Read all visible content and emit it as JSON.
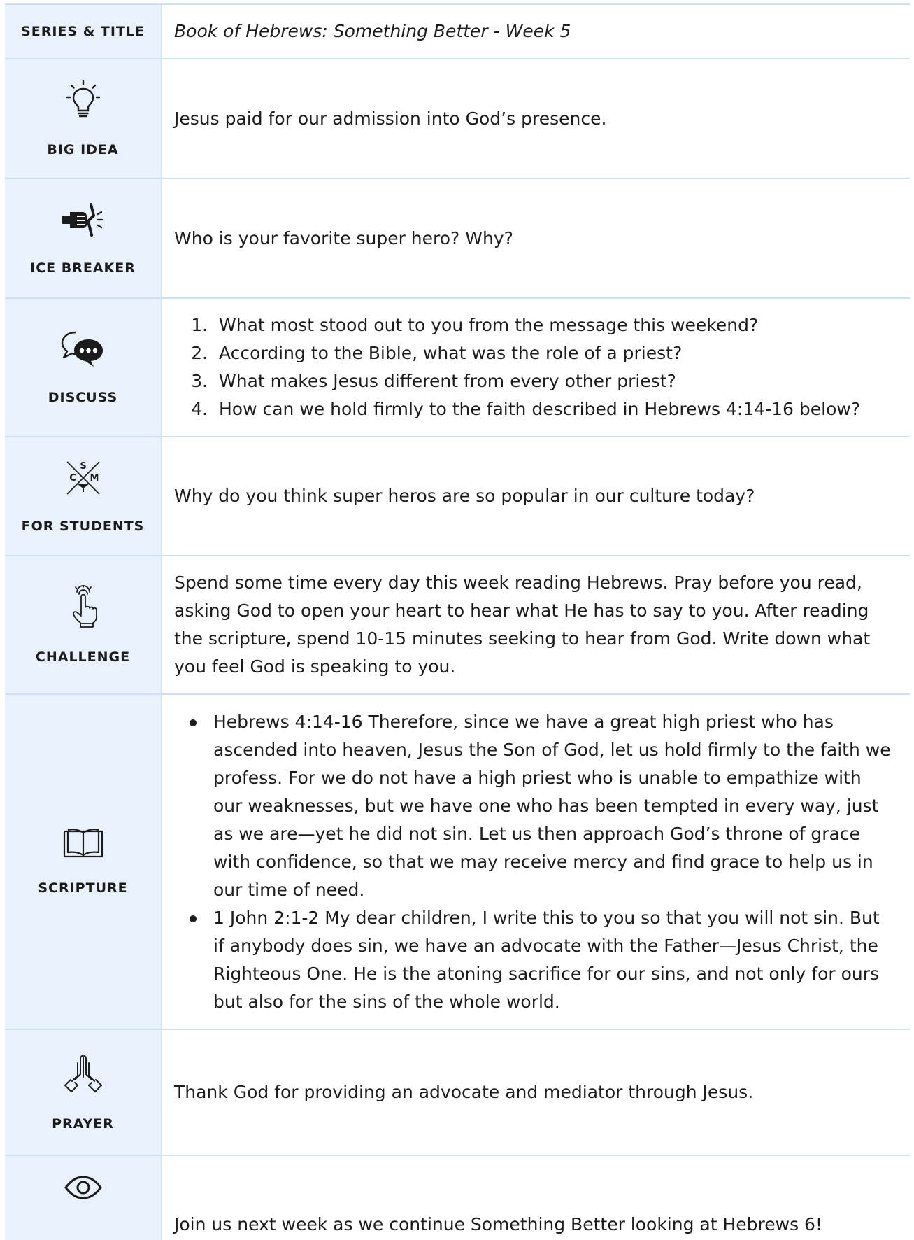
{
  "series": {
    "label": "SERIES & TITLE",
    "value": "Book of Hebrews: Something Better - Week 5"
  },
  "big_idea": {
    "label": "BIG IDEA",
    "icon": "lightbulb-icon",
    "text": "Jesus paid for our admission into God’s presence."
  },
  "ice_breaker": {
    "label": "ICE BREAKER",
    "icon": "fist-breaking-icon",
    "text": "Who is your favorite super hero? Why?"
  },
  "discuss": {
    "label": "DISCUSS",
    "icon": "chat-bubbles-icon",
    "questions": [
      "What most stood out to you from the message this weekend?",
      "According to the Bible, what was the role of a priest?",
      "What makes Jesus different from every other priest?",
      "How can we hold firmly to the faith described in Hebrews 4:14-16 below?"
    ]
  },
  "for_students": {
    "label": "FOR STUDENTS",
    "icon": "csm-cross-logo-icon",
    "logo_letters": [
      "S",
      "C",
      "M"
    ],
    "text": "Why do you think super heros are so popular in our culture today?"
  },
  "challenge": {
    "label": "CHALLENGE",
    "icon": "tapping-hand-icon",
    "text": "Spend some time every day this week reading Hebrews. Pray before you read, asking God to open your heart to hear what He has to say to you. After reading the scripture, spend 10-15 minutes seeking to hear from God. Write down what you feel God is speaking to you."
  },
  "scripture": {
    "label": "SCRIPTURE",
    "icon": "open-book-icon",
    "passages": [
      "Hebrews 4:14-16 Therefore, since we have a great high priest who has ascended into heaven, Jesus the Son of God, let us hold firmly to the faith we profess. For we do not have a high priest who is unable to empathize with our weaknesses, but we have one who has been tempted in every way, just as we are—yet he did not sin. Let us then approach God’s throne of grace with confidence, so that we may receive mercy and find grace to help us in our time of need.",
      " 1 John 2:1-2 My dear children, I write this to you so that you will not sin. But if anybody does sin, we have an advocate with the Father—Jesus Christ, the Righteous One. He is the atoning sacrifice for our sins, and not only for ours but also for the sins of the whole world."
    ]
  },
  "prayer": {
    "label": "PRAYER",
    "icon": "praying-hands-icon",
    "text": "Thank God for providing an advocate and mediator through Jesus."
  },
  "next_week": {
    "icon": "eye-icon",
    "text": "Join us next week as we continue Something Better looking at Hebrews 6!"
  },
  "colors": {
    "label_bg": "#e9f2fc",
    "border": "#cfe0f3",
    "text": "#1c1c1c"
  }
}
